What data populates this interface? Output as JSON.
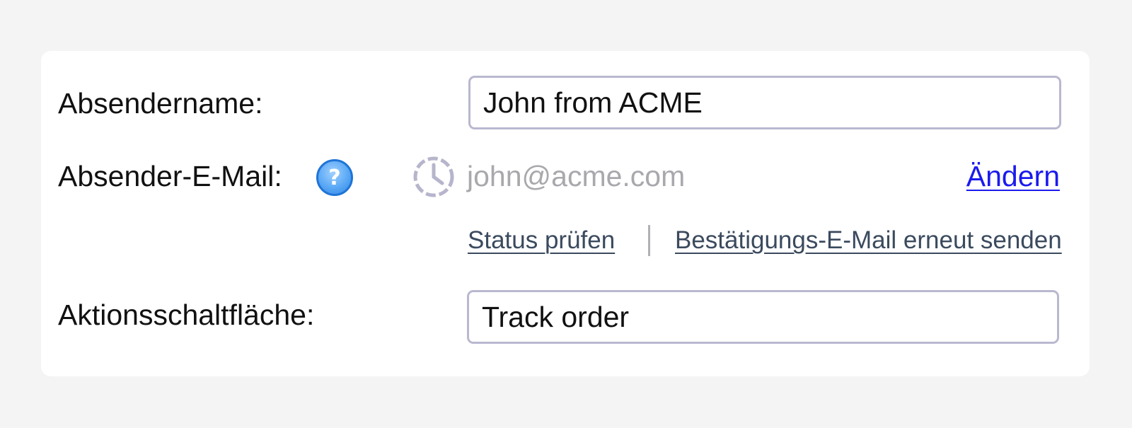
{
  "form": {
    "sender_name": {
      "label": "Absendername:",
      "value": "John from ACME"
    },
    "sender_email": {
      "label": "Absender-E-Mail:",
      "help_icon": "question-mark-icon",
      "status_icon": "clock-pending-icon",
      "value": "john@acme.com",
      "change_link": "Ändern",
      "check_status_link": "Status prüfen",
      "resend_link": "Bestätigungs-E-Mail erneut senden"
    },
    "action_button": {
      "label": "Aktionsschaltfläche:",
      "value": "Track order"
    }
  },
  "colors": {
    "link_primary": "#1a1aee",
    "link_secondary": "#3b4a5e",
    "input_border": "#b9b8d0",
    "muted_text": "#a8a8ad",
    "help_icon": "#3f95ee"
  }
}
